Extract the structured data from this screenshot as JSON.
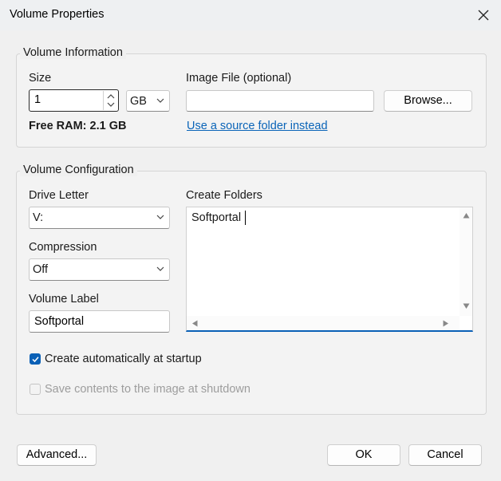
{
  "window": {
    "title": "Volume Properties"
  },
  "volume_information": {
    "legend": "Volume Information",
    "size_label": "Size",
    "size_value": "1",
    "size_unit": "GB",
    "free_ram": "Free RAM: 2.1 GB",
    "image_file_label": "Image File (optional)",
    "image_file_value": "",
    "browse_label": "Browse...",
    "source_folder_link": "Use a source folder instead"
  },
  "volume_configuration": {
    "legend": "Volume Configuration",
    "drive_letter_label": "Drive Letter",
    "drive_letter_value": "V:",
    "compression_label": "Compression",
    "compression_value": "Off",
    "volume_label_label": "Volume Label",
    "volume_label_value": "Softportal",
    "create_folders_label": "Create Folders",
    "create_folders_value": "Softportal",
    "auto_create_label": "Create automatically at startup",
    "auto_create_checked": true,
    "save_contents_label": "Save contents to the image at shutdown",
    "save_contents_checked": false
  },
  "footer": {
    "advanced_label": "Advanced...",
    "ok_label": "OK",
    "cancel_label": "Cancel"
  },
  "colors": {
    "accent": "#0a60b6",
    "link": "#0a64b8",
    "background": "#f0f0f0"
  },
  "icons": [
    "close-icon",
    "spin-up-icon",
    "spin-down-icon",
    "chevron-down-icon",
    "scroll-up-icon",
    "scroll-down-icon",
    "scroll-left-icon",
    "scroll-right-icon",
    "checkmark-icon"
  ]
}
